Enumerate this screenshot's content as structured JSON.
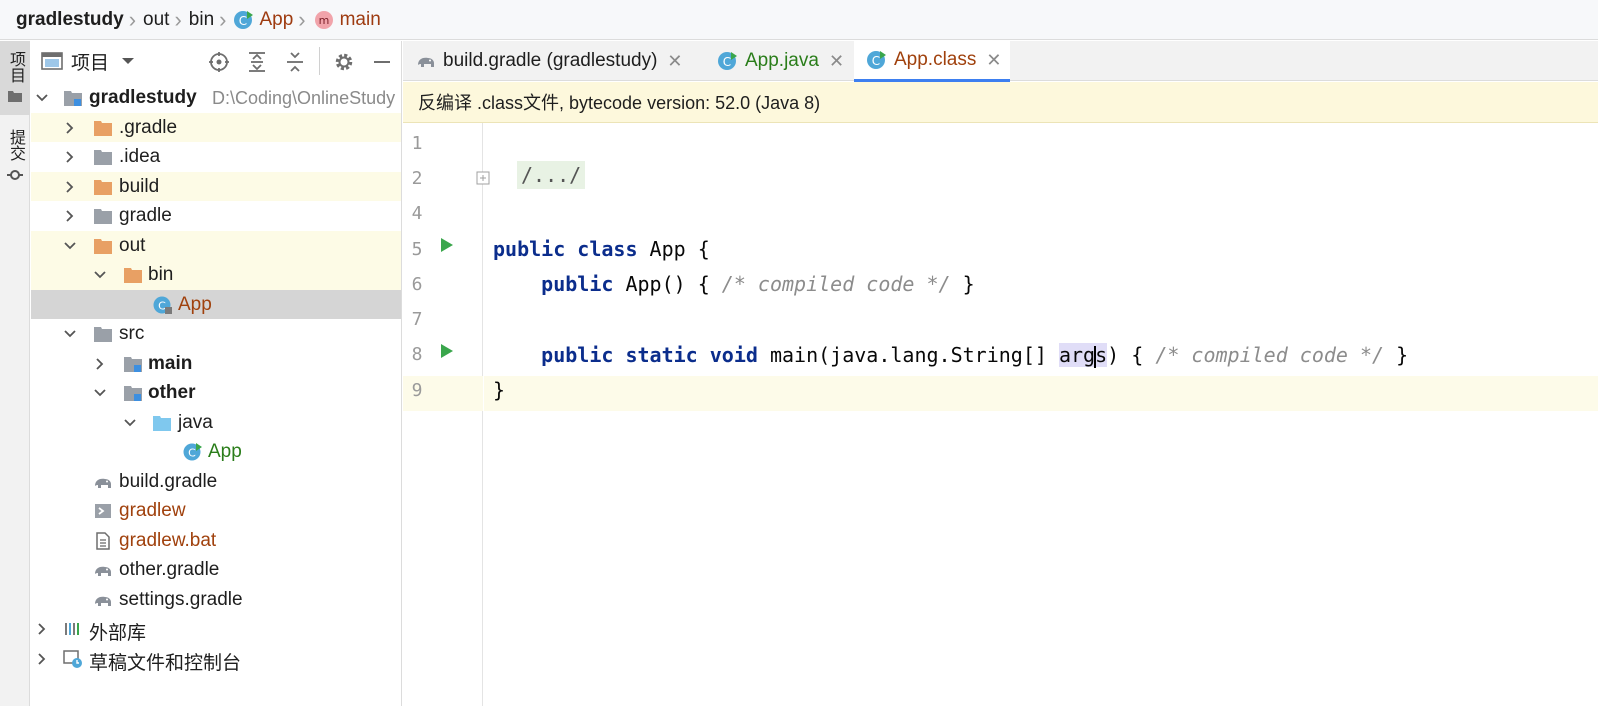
{
  "breadcrumb": {
    "project": "gradlestudy",
    "dir1": "out",
    "dir2": "bin",
    "class_name": "App",
    "method_name": "main"
  },
  "left_strip": {
    "project_tab": "项目",
    "commit_tab": "提交"
  },
  "panel": {
    "title": "项目"
  },
  "tree": {
    "root_name": "gradlestudy",
    "root_path": "D:\\Coding\\OnlineStudy",
    "gradle_dir": ".gradle",
    "idea_dir": ".idea",
    "build_dir": "build",
    "gradle_folder": "gradle",
    "out_dir": "out",
    "bin_dir": "bin",
    "app_class": "App",
    "src_dir": "src",
    "main_dir": "main",
    "other_dir": "other",
    "java_dir": "java",
    "app_java": "App",
    "build_gradle": "build.gradle",
    "gradlew": "gradlew",
    "gradlew_bat": "gradlew.bat",
    "other_gradle": "other.gradle",
    "settings_gradle": "settings.gradle",
    "external_libs": "外部库",
    "scratches": "草稿文件和控制台"
  },
  "tabs": {
    "tab1": "build.gradle (gradlestudy)",
    "tab2": "App.java",
    "tab3": "App.class"
  },
  "banner": {
    "text": "反编译 .class文件, bytecode version: 52.0 (Java 8)"
  },
  "code": {
    "line_numbers": [
      "1",
      "2",
      "4",
      "5",
      "6",
      "7",
      "8",
      "9"
    ],
    "folded": "/.../",
    "kw_public": "public",
    "kw_class": "class",
    "kw_static": "static",
    "kw_void": "void",
    "class_decl_rest": " App {",
    "ctor_name": " App() { ",
    "compiled_comment": "/* compiled code */",
    "close_brace": " }",
    "main_sig": " main(java.lang.String[] ",
    "arg_before_caret": "arg",
    "arg_after_caret": "s",
    "main_after_arg": ") { ",
    "class_close": "}"
  },
  "colors": {
    "accent": "#3d7ff0",
    "keyword": "#0b2d8c",
    "comment": "#8c8c8c",
    "excluded_folder": "#e8a064",
    "class_icon": "#4fa7d8",
    "run_green": "#3aa64c"
  }
}
